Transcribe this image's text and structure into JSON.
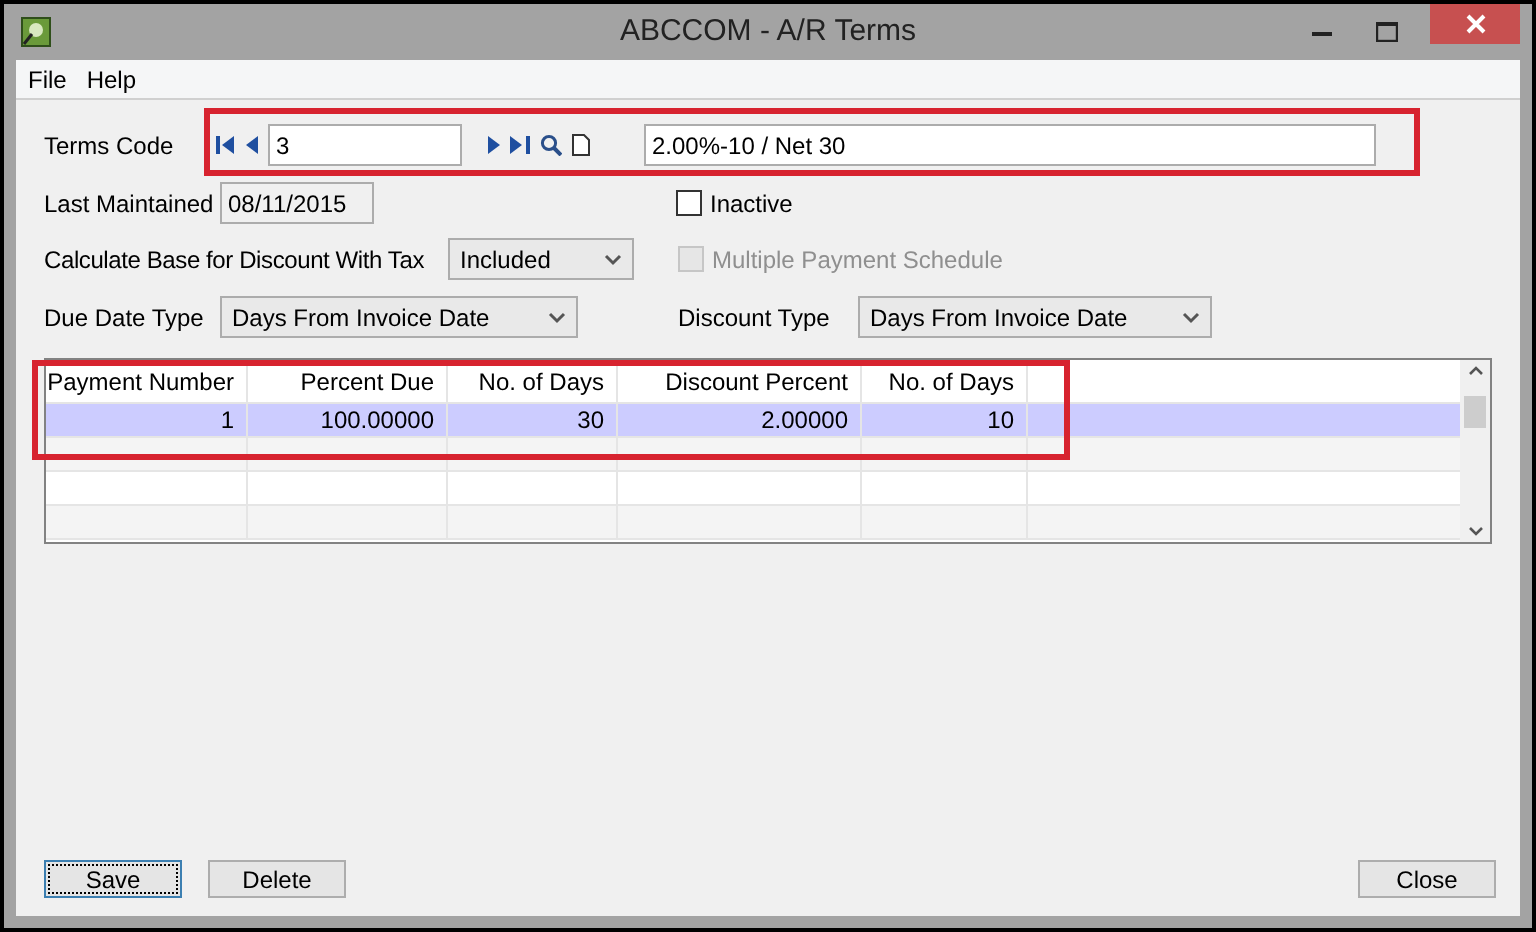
{
  "window": {
    "title": "ABCCOM - A/R Terms"
  },
  "menu": [
    "File",
    "Help"
  ],
  "terms_code": {
    "label": "Terms Code",
    "value": "3",
    "description": "2.00%-10 / Net 30"
  },
  "last_maintained": {
    "label": "Last Maintained",
    "value": "08/11/2015"
  },
  "inactive": {
    "label": "Inactive",
    "checked": false,
    "disabled": false
  },
  "calc_base": {
    "label": "Calculate Base for Discount With Tax",
    "value": "Included"
  },
  "multiple_schedule": {
    "label": "Multiple Payment Schedule",
    "checked": false,
    "disabled": true
  },
  "due_date_type": {
    "label": "Due Date Type",
    "value": "Days From Invoice Date"
  },
  "discount_type": {
    "label": "Discount Type",
    "value": "Days From Invoice Date"
  },
  "table": {
    "columns": [
      "Payment Number",
      "Percent Due",
      "No. of Days",
      "Discount Percent",
      "No. of Days"
    ],
    "rows": [
      {
        "cells": [
          "1",
          "100.00000",
          "30",
          "2.00000",
          "10"
        ],
        "selected": true
      }
    ]
  },
  "buttons": [
    {
      "label": "Save",
      "focused": true
    },
    {
      "label": "Delete",
      "focused": false
    },
    {
      "label": "Close",
      "focused": false
    }
  ]
}
